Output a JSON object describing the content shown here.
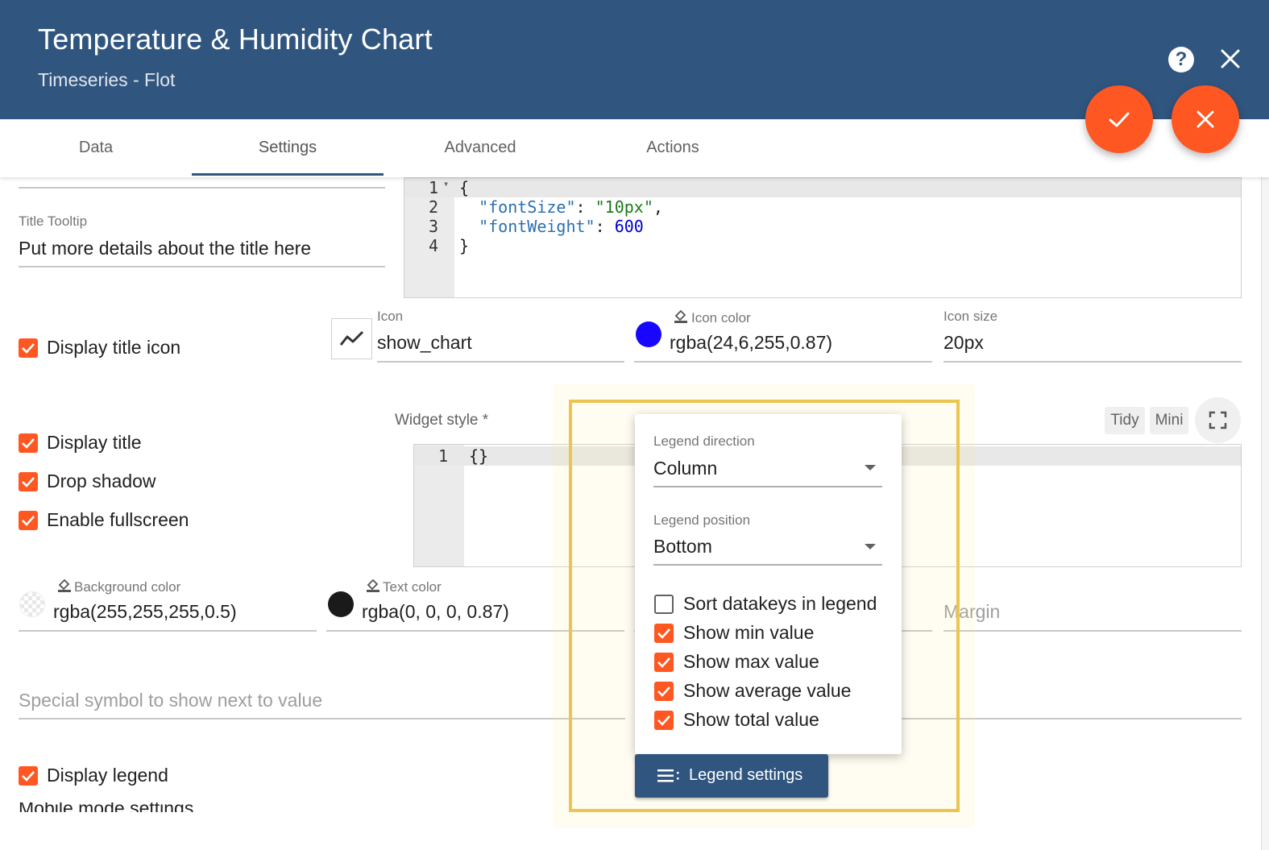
{
  "header": {
    "title": "Temperature & Humidity Chart",
    "subtitle": "Timeseries - Flot",
    "help_icon": "help-circle-icon",
    "close_icon": "close-icon"
  },
  "fabs": {
    "apply_icon": "check-icon",
    "cancel_icon": "close-icon",
    "color": "#ff5722"
  },
  "tabs": [
    {
      "label": "Data"
    },
    {
      "label": "Settings"
    },
    {
      "label": "Advanced"
    },
    {
      "label": "Actions"
    }
  ],
  "active_tab": "Settings",
  "title_tooltip": {
    "label": "Title Tooltip",
    "value": "Put more details about the title here"
  },
  "title_style_editor": {
    "lines": [
      "1",
      "2",
      "3",
      "4"
    ],
    "code": {
      "open": "{",
      "k1": "\"fontSize\"",
      "v1": "\"10px\"",
      "k2": "\"fontWeight\"",
      "v2": "600",
      "close": "}"
    }
  },
  "display_title_icon": {
    "label": "Display title icon",
    "checked": true
  },
  "icon": {
    "label": "Icon",
    "value": "show_chart",
    "glyph": "show-chart-icon"
  },
  "icon_color": {
    "label": "Icon color",
    "value": "rgba(24,6,255,0.87)",
    "swatch": "#1806ff"
  },
  "icon_size": {
    "label": "Icon size",
    "value": "20px"
  },
  "widget_style": {
    "label": "Widget style *",
    "line": "1",
    "code": "{}",
    "tidy": "Tidy",
    "mini": "Mini"
  },
  "checkboxes": [
    {
      "label": "Display title",
      "checked": true
    },
    {
      "label": "Drop shadow",
      "checked": true
    },
    {
      "label": "Enable fullscreen",
      "checked": true
    }
  ],
  "background_color": {
    "label": "Background color",
    "value": "rgba(255,255,255,0.5)"
  },
  "text_color": {
    "label": "Text color",
    "value": "rgba(0, 0, 0, 0.87)",
    "swatch": "#1a1a1a"
  },
  "margin": {
    "placeholder": "Margin"
  },
  "units": {
    "placeholder": "Special symbol to show next to value"
  },
  "display_legend": {
    "label": "Display legend",
    "checked": true
  },
  "cut_label": "Mobile mode settings",
  "legend_popover": {
    "direction": {
      "label": "Legend direction",
      "value": "Column"
    },
    "position": {
      "label": "Legend position",
      "value": "Bottom"
    },
    "options": [
      {
        "label": "Sort datakeys in legend",
        "checked": false
      },
      {
        "label": "Show min value",
        "checked": true
      },
      {
        "label": "Show max value",
        "checked": true
      },
      {
        "label": "Show average value",
        "checked": true
      },
      {
        "label": "Show total value",
        "checked": true
      }
    ]
  },
  "legend_button": {
    "label": "Legend settings",
    "icon": "legend-list-icon"
  },
  "colors": {
    "header": "#305680",
    "accent": "#ff5722",
    "highlight": "#eac54f"
  }
}
